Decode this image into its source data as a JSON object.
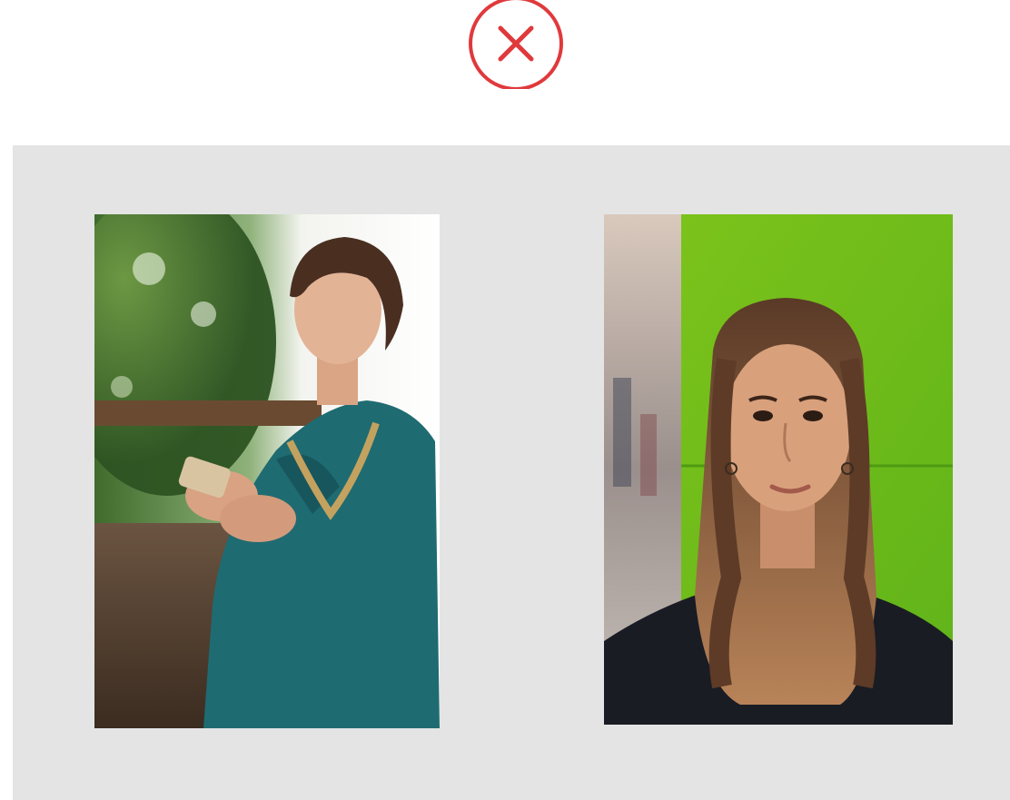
{
  "status": {
    "icon": "close-circle-icon",
    "color": "#e0393c"
  },
  "panel": {
    "background": "#e4e4e4",
    "photos": [
      {
        "name": "woman-with-phone-photo",
        "description_icon": "photo"
      },
      {
        "name": "portrait-green-wall-photo",
        "description_icon": "photo"
      }
    ]
  }
}
